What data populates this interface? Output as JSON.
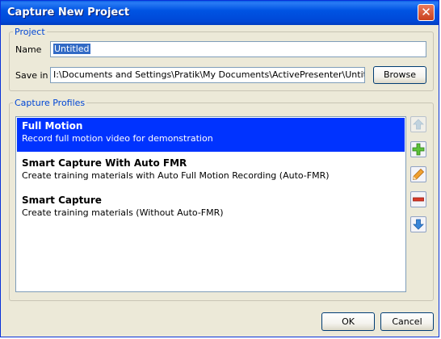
{
  "window": {
    "title": "Capture New Project",
    "close_glyph": "✕"
  },
  "project": {
    "legend": "Project",
    "name_label": "Name",
    "name_value": "Untitled",
    "savein_label": "Save in",
    "savein_value": "I:\\Documents and Settings\\Pratik\\My Documents\\ActivePresenter\\Untitled.approj",
    "browse_label": "Browse"
  },
  "profiles": {
    "legend": "Capture Profiles",
    "items": [
      {
        "name": "Full Motion",
        "description": "Record full motion video for demonstration",
        "selected": true
      },
      {
        "name": "Smart Capture With Auto FMR",
        "description": "Create training materials with Auto Full Motion Recording (Auto-FMR)",
        "selected": false
      },
      {
        "name": "Smart Capture",
        "description": "Create training materials (Without Auto-FMR)",
        "selected": false
      }
    ],
    "tools": [
      "arrow-up-icon",
      "plus-icon",
      "pencil-icon",
      "minus-icon",
      "arrow-down-icon"
    ]
  },
  "footer": {
    "ok_label": "OK",
    "cancel_label": "Cancel"
  },
  "colors": {
    "title_bar": "#0054e3",
    "selection": "#0033ff",
    "group_legend": "#0046d5",
    "dialog_bg": "#ece9d8"
  }
}
